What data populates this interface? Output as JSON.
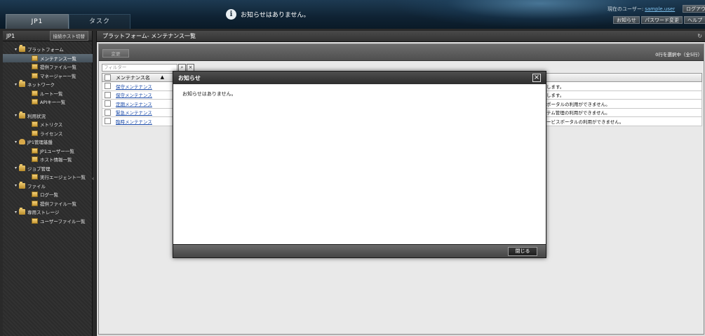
{
  "header": {
    "tabs": [
      "JP1",
      "タスク"
    ],
    "notice": "お知らせはありません。",
    "user_label": "現在のユーザー:",
    "user_name": "sample.user",
    "logout": "ログアウ",
    "buttons": [
      "お知らせ",
      "パスワード変更",
      "ヘルプ"
    ]
  },
  "sidebar": {
    "title": "JP1",
    "switch_host": "接続ホスト切替",
    "items": [
      {
        "label": "プラットフォーム",
        "type": "cat",
        "icon": "folder-icon"
      },
      {
        "label": "メンテナンス一覧",
        "type": "leaf",
        "icon": "page-icon"
      },
      {
        "label": "提供ファイル一覧",
        "type": "leaf",
        "icon": "page-icon"
      },
      {
        "label": "マネージャー一覧",
        "type": "leaf",
        "icon": "page-icon"
      },
      {
        "label": "ネットワーク",
        "type": "cat",
        "icon": "folder-icon"
      },
      {
        "label": "ルート一覧",
        "type": "leaf",
        "icon": "page-icon"
      },
      {
        "label": "APIキー一覧",
        "type": "leaf",
        "icon": "page-icon"
      },
      {
        "label": "利用状況",
        "type": "cat",
        "icon": "folder-icon"
      },
      {
        "label": "メトリクス",
        "type": "leaf",
        "icon": "page-icon"
      },
      {
        "label": "ライセンス",
        "type": "leaf",
        "icon": "page-icon"
      },
      {
        "label": "JP1管理基盤",
        "type": "cat",
        "icon": "person-icon"
      },
      {
        "label": "JP1ユーザー一覧",
        "type": "leaf",
        "icon": "page-icon"
      },
      {
        "label": "ホスト情報一覧",
        "type": "leaf",
        "icon": "page-icon"
      },
      {
        "label": "ジョブ管理",
        "type": "cat",
        "icon": "folder-icon"
      },
      {
        "label": "実行エージェント一覧",
        "type": "leaf",
        "icon": "page-icon"
      },
      {
        "label": "ファイル",
        "type": "cat",
        "icon": "folder-icon"
      },
      {
        "label": "ログ一覧",
        "type": "leaf",
        "icon": "page-icon"
      },
      {
        "label": "提供ファイル一覧",
        "type": "leaf",
        "icon": "page-icon"
      },
      {
        "label": "専用ストレージ",
        "type": "cat",
        "icon": "folder-icon"
      },
      {
        "label": "ユーザーファイル一覧",
        "type": "leaf",
        "icon": "page-icon"
      }
    ]
  },
  "main": {
    "title": "プラットフォーム- メンテナンス一覧",
    "change_button": "変更",
    "selection_count": "0行を選択中（全5行）",
    "filter_placeholder": "フィルター",
    "column_name": "メンテナンス名",
    "sort_indicator": "▲",
    "rows": [
      {
        "name": "保守メンテナンス",
        "desc": "止が発生します。"
      },
      {
        "name": "保守メンテナンス",
        "desc": "止が発生します。"
      },
      {
        "name": "定期メンテナンス",
        "desc": "サービスポータルの利用ができません。"
      },
      {
        "name": "緊急メンテナンス",
        "desc": "中はシステム管理の利用ができません。"
      },
      {
        "name": "臨時メンテナンス",
        "desc": "ス中はサービスポータルの利用ができません。"
      }
    ]
  },
  "modal": {
    "title": "お知らせ",
    "message": "お知らせはありません。",
    "close_label": "閉じる",
    "close_icon": "×"
  }
}
